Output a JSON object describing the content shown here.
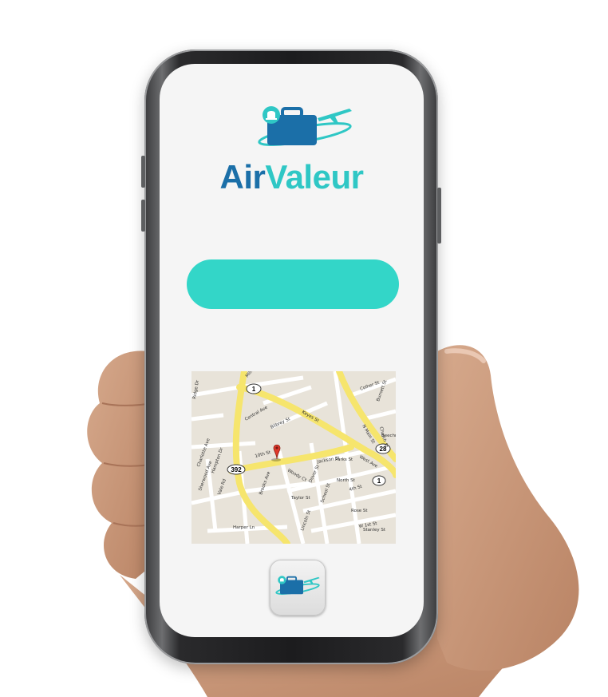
{
  "brand": {
    "name_part1": "Air",
    "name_part2": "Valeur",
    "primary_color": "#1b6fa8",
    "accent_color": "#2fc7c5"
  },
  "main": {
    "cta_button": {
      "label": "",
      "color": "#33d6c8"
    }
  },
  "map": {
    "route_labels": [
      "1",
      "392",
      "28",
      "1"
    ],
    "street_labels": [
      "Miller Ave",
      "Central Ave",
      "Bilbrey St",
      "Keyes St",
      "Colher St",
      "Burnett St",
      "N Main St",
      "Church St",
      "Beechnut",
      "West Ave",
      "10th St",
      "Woody Ct",
      "Dover St",
      "Jackson St",
      "Parks St",
      "North St",
      "School St",
      "4th St",
      "Rose St",
      "W 1st St",
      "Taylor St",
      "Harper Ln",
      "Stanley St",
      "Lincoln St",
      "Charlotte Ave",
      "Sherwood Ave",
      "Hampton Dr",
      "Vale Rd",
      "Ridge Dr",
      "Brooks Ave"
    ],
    "marker_icon": "location-pin-icon"
  },
  "dock": {
    "app_icon": "airvaleur-app-icon"
  }
}
